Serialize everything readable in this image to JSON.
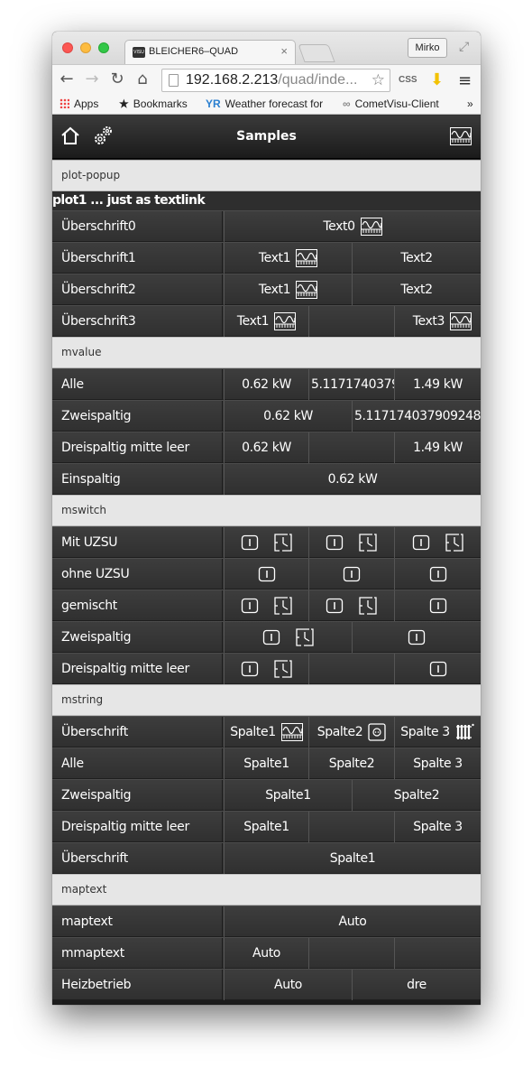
{
  "browser": {
    "tab_title": "BLEICHER6–QUAD",
    "tab_favicon": "VISU",
    "tab_close": "×",
    "user": "Mirko",
    "url_host": "192.168.2.213",
    "url_path": "/quad/inde...",
    "bookmarks": {
      "apps": "Apps",
      "bookmarks": "Bookmarks",
      "weather": "Weather forecast for",
      "weather_icon": "YR",
      "cometvisu": "CometVisu-Client",
      "more": "»"
    },
    "ext_css": "CSS"
  },
  "header": {
    "title": "Samples"
  },
  "plot_popup": {
    "section": "plot-popup",
    "textlink": "plot1 ... just as textlink",
    "rows": [
      {
        "label": "Überschrift0",
        "c1": "Text0"
      },
      {
        "label": "Überschrift1",
        "c1": "Text1",
        "c2": "Text2"
      },
      {
        "label": "Überschrift2",
        "c1": "Text1",
        "c2": "Text2"
      },
      {
        "label": "Überschrift3",
        "c1": "Text1",
        "c3": "Text3"
      }
    ]
  },
  "mvalue": {
    "section": "mvalue",
    "rows": [
      {
        "label": "Alle",
        "c1": "0.62 kW",
        "c2": "5.1171740379…",
        "c3": "1.49 kW"
      },
      {
        "label": "Zweispaltig",
        "c1": "0.62 kW",
        "c2": "5.117174037909248 …"
      },
      {
        "label": "Dreispaltig mitte leer",
        "c1": "0.62 kW",
        "c3": "1.49 kW"
      },
      {
        "label": "Einspaltig",
        "c1": "0.62 kW"
      }
    ]
  },
  "mswitch": {
    "section": "mswitch",
    "rows": [
      {
        "label": "Mit UZSU"
      },
      {
        "label": "ohne UZSU"
      },
      {
        "label": "gemischt"
      },
      {
        "label": "Zweispaltig"
      },
      {
        "label": "Dreispaltig mitte leer"
      }
    ]
  },
  "mstring": {
    "section": "mstring",
    "rows": [
      {
        "label": "Überschrift",
        "c1": "Spalte1",
        "c2": "Spalte2",
        "c3": "Spalte 3"
      },
      {
        "label": "Alle",
        "c1": "Spalte1",
        "c2": "Spalte2",
        "c3": "Spalte 3"
      },
      {
        "label": "Zweispaltig",
        "c1": "Spalte1",
        "c2": "Spalte2"
      },
      {
        "label": "Dreispaltig mitte leer",
        "c1": "Spalte1",
        "c3": "Spalte 3"
      },
      {
        "label": "Überschrift",
        "c1": "Spalte1"
      }
    ]
  },
  "maptext": {
    "section": "maptext",
    "rows": [
      {
        "label": "maptext",
        "c1": "Auto"
      },
      {
        "label": "mmaptext",
        "c1": "Auto"
      },
      {
        "label": "Heizbetrieb",
        "c1": "Auto",
        "c2": "dre"
      }
    ]
  }
}
